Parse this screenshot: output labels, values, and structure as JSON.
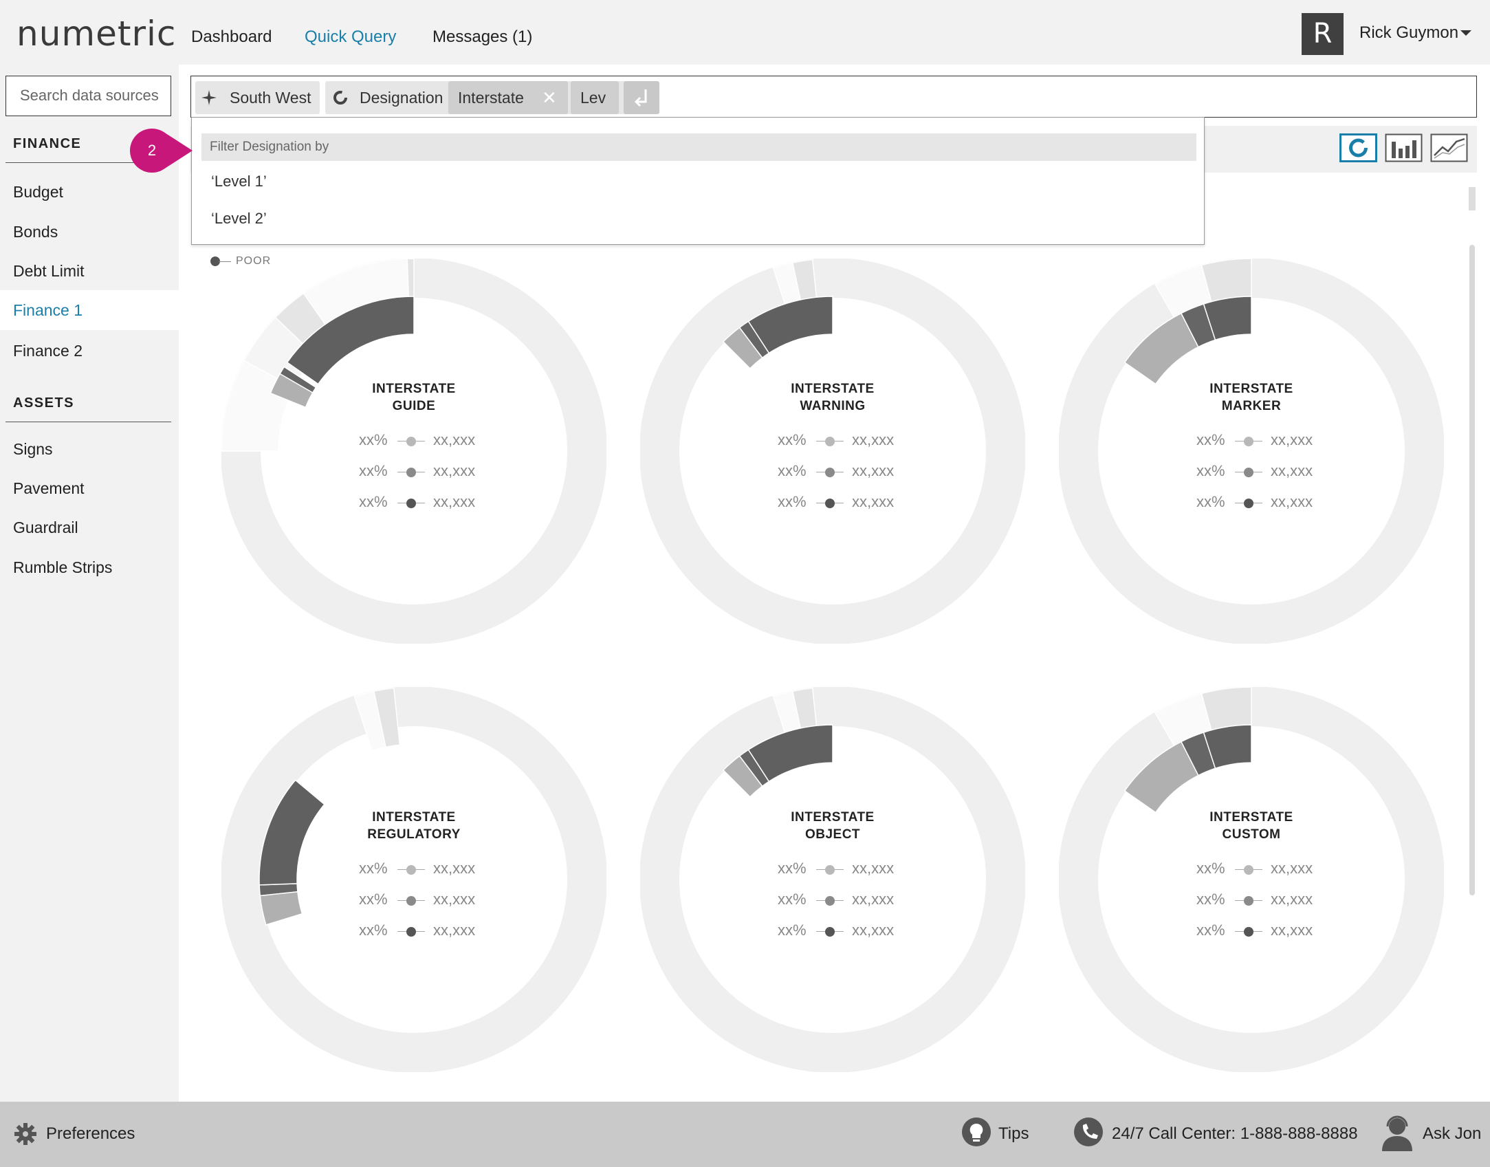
{
  "app": {
    "logo": "numetric"
  },
  "nav": [
    {
      "label": "Dashboard",
      "active": false
    },
    {
      "label": "Quick Query",
      "active": true
    },
    {
      "label": "Messages (1)",
      "active": false
    }
  ],
  "user": {
    "initial": "R",
    "name": "Rick Guymon"
  },
  "sidebar": {
    "search_placeholder": "Search data sources",
    "sections": [
      {
        "heading": "FINANCE",
        "items": [
          "Budget",
          "Bonds",
          "Debt Limit",
          "Finance 1",
          "Finance 2"
        ],
        "active": "Finance 1"
      },
      {
        "heading": "ASSETS",
        "items": [
          "Signs",
          "Pavement",
          "Guardrail",
          "Rumble Strips"
        ]
      }
    ]
  },
  "query": {
    "chips": [
      {
        "label": "South West",
        "icon": "sparkle-icon"
      },
      {
        "label": "Designation",
        "icon": "donut-icon"
      },
      {
        "label": "Interstate",
        "removable": true
      },
      {
        "label": "Lev"
      }
    ],
    "enter_icon": "enter-icon"
  },
  "dropdown": {
    "header": "Filter Designation by",
    "items": [
      "‘Level 1’",
      "‘Level 2’"
    ]
  },
  "badge": {
    "number": "2",
    "color": "#c8177a"
  },
  "view_icons": [
    "donut-view-icon",
    "bar-view-icon",
    "line-view-icon"
  ],
  "accent_color": "#1a7fa8",
  "legend": {
    "label": "POOR"
  },
  "charts": [
    {
      "title_line1": "INTERSTATE",
      "title_line2": "GUIDE",
      "stats": [
        {
          "pct": "xx%",
          "val": "xx,xxx"
        },
        {
          "pct": "xx%",
          "val": "xx,xxx"
        },
        {
          "pct": "xx%",
          "val": "xx,xxx"
        }
      ]
    },
    {
      "title_line1": "INTERSTATE",
      "title_line2": "WARNING",
      "stats": [
        {
          "pct": "xx%",
          "val": "xx,xxx"
        },
        {
          "pct": "xx%",
          "val": "xx,xxx"
        },
        {
          "pct": "xx%",
          "val": "xx,xxx"
        }
      ]
    },
    {
      "title_line1": "INTERSTATE",
      "title_line2": "MARKER",
      "stats": [
        {
          "pct": "xx%",
          "val": "xx,xxx"
        },
        {
          "pct": "xx%",
          "val": "xx,xxx"
        },
        {
          "pct": "xx%",
          "val": "xx,xxx"
        }
      ]
    },
    {
      "title_line1": "INTERSTATE",
      "title_line2": "REGULATORY",
      "stats": [
        {
          "pct": "xx%",
          "val": "xx,xxx"
        },
        {
          "pct": "xx%",
          "val": "xx,xxx"
        },
        {
          "pct": "xx%",
          "val": "xx,xxx"
        }
      ]
    },
    {
      "title_line1": "INTERSTATE",
      "title_line2": "OBJECT",
      "stats": [
        {
          "pct": "xx%",
          "val": "xx,xxx"
        },
        {
          "pct": "xx%",
          "val": "xx,xxx"
        },
        {
          "pct": "xx%",
          "val": "xx,xxx"
        }
      ]
    },
    {
      "title_line1": "INTERSTATE",
      "title_line2": "CUSTOM",
      "stats": [
        {
          "pct": "xx%",
          "val": "xx,xxx"
        },
        {
          "pct": "xx%",
          "val": "xx,xxx"
        },
        {
          "pct": "xx%",
          "val": "xx,xxx"
        }
      ]
    }
  ],
  "footer": {
    "preferences": "Preferences",
    "tips": "Tips",
    "call_center": "24/7 Call Center: 1-888-888-8888",
    "ask": "Ask Jon"
  }
}
